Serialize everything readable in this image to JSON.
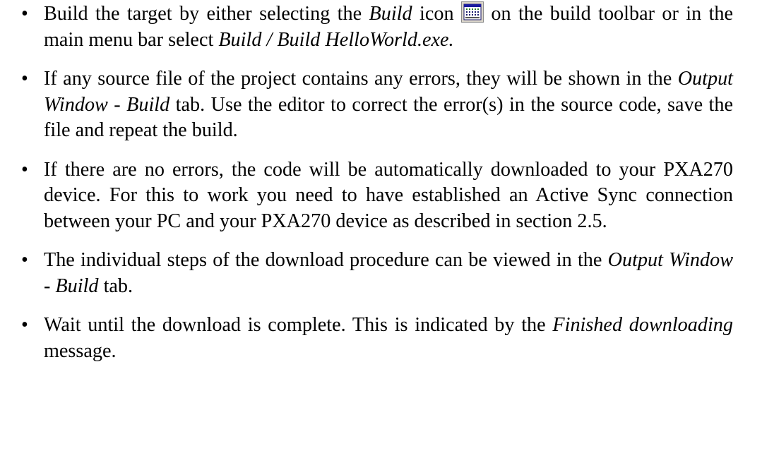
{
  "bullets": [
    {
      "t1": "Build the target by either selecting the ",
      "e1": "Build",
      "t2": " icon ",
      "icon": "build-icon",
      "t3": " on the build toolbar or in the main menu bar select ",
      "e2": "Build / Build HelloWorld.exe."
    },
    {
      "t1": "If any source file of the project contains any errors, they will be shown in the ",
      "e1": "Output Window - Build",
      "t2": " tab. Use the editor to correct the error(s) in the source code, save the file and repeat the build."
    },
    {
      "t1": "If there are no errors, the code will be automatically downloaded to your PXA270 device. For this to work you need to have established an Active Sync connection between your PC and your PXA270 device as described in section 2.5."
    },
    {
      "t1": "The individual steps of the download procedure can be viewed in the ",
      "e1": "Output Window - Build",
      "t2": " tab."
    },
    {
      "t1": "Wait until the download is complete. This is indicated by the ",
      "e1": "Finished downloading",
      "t2": " message."
    }
  ],
  "bullet_glyph": "•"
}
